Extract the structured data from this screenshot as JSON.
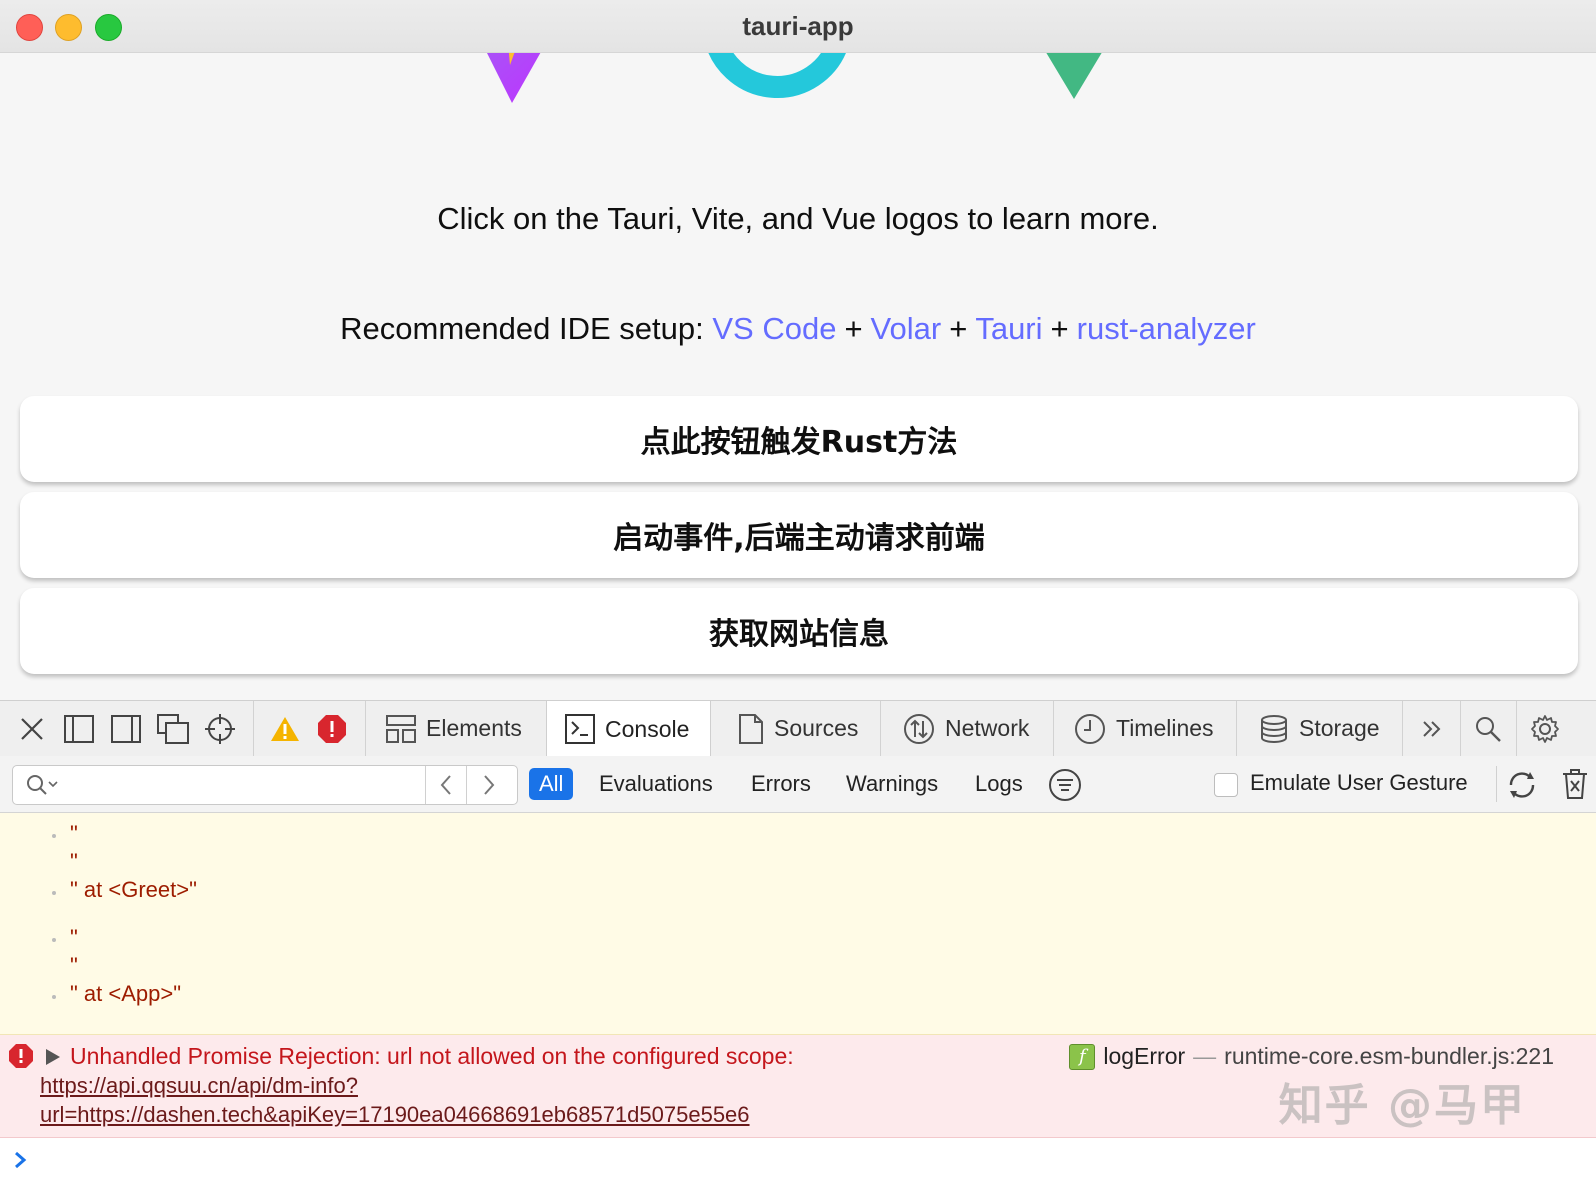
{
  "window": {
    "title": "tauri-app"
  },
  "app": {
    "intro_text": "Click on the Tauri, Vite, and Vue logos to learn more.",
    "ide_prefix": "Recommended IDE setup: ",
    "ide_links": [
      "VS Code",
      "Volar",
      "Tauri",
      "rust-analyzer"
    ],
    "ide_separator": "+",
    "buttons": [
      "点此按钮触发Rust方法",
      "启动事件,后端主动请求前端",
      "获取网站信息"
    ],
    "colors": {
      "link": "#646cff",
      "vite_purple": "#bd34fe",
      "tauri_cyan": "#24c8db",
      "vue_green": "#42b883"
    }
  },
  "devtools": {
    "tabs": [
      "Elements",
      "Console",
      "Sources",
      "Network",
      "Timelines",
      "Storage"
    ],
    "active_tab": "Console",
    "more_tabs_icon": "chevron-double-right-icon",
    "filter": {
      "placeholder": "",
      "levels": [
        "All",
        "Evaluations",
        "Errors",
        "Warnings",
        "Logs"
      ],
      "active_level": "All",
      "emulate_label": "Emulate User Gesture"
    },
    "console": {
      "warning_lines": [
        "\"",
        "\"",
        "\" at <Greet>\"",
        "\"",
        "\"",
        "\" at <App>\""
      ],
      "error": {
        "message": "Unhandled Promise Rejection: url not allowed on the configured scope:",
        "link_line1": "https://api.qqsuu.cn/api/dm-info?",
        "link_line2": "url=https://dashen.tech&apiKey=17190ea04668691eb68571d5075e55e6",
        "function": "logError",
        "dash": "—",
        "source": "runtime-core.esm-bundler.js:221"
      }
    },
    "watermark": "知乎 @马甲"
  }
}
